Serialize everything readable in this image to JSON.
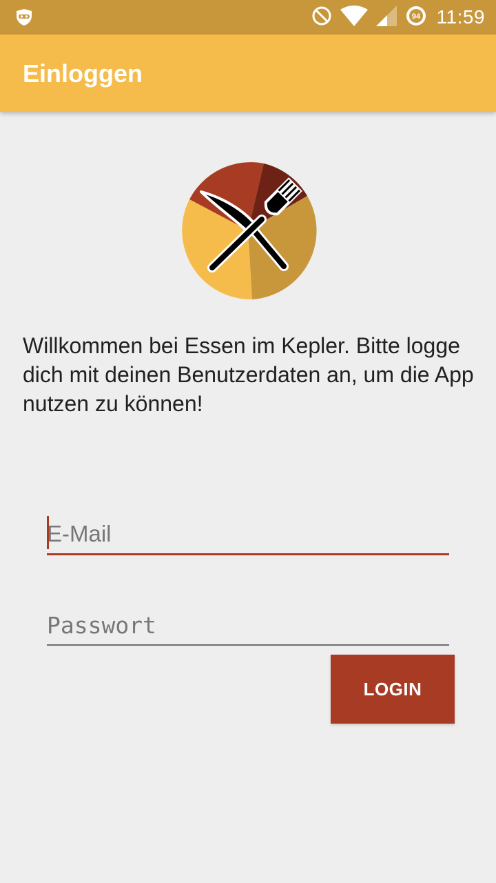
{
  "status_bar": {
    "time": "11:59",
    "battery_level": "94",
    "icons": [
      "ninja-mode-icon",
      "do-not-disturb-icon",
      "wifi-icon",
      "cell-signal-icon",
      "battery-icon"
    ]
  },
  "app_bar": {
    "title": "Einloggen",
    "color": "#f5bc4c"
  },
  "logo": {
    "icon": "fork-knife-icon",
    "colors": [
      "#a83b24",
      "#6e2216",
      "#c8973c",
      "#f5bc4c"
    ]
  },
  "welcome_text": "Willkommen bei Essen im Kepler. Bitte logge dich mit deinen Benutzerdaten an, um die App nutzen zu können!",
  "form": {
    "email_placeholder": "E-Mail",
    "password_placeholder": "Passwort",
    "login_label": "LOGIN"
  },
  "colors": {
    "status_bar": "#c8973c",
    "accent": "#a83b24",
    "background": "#eeeeee"
  }
}
